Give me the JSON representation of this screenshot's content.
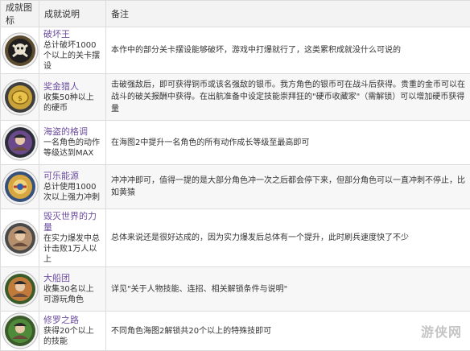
{
  "header": {
    "col_icon": "成就图标",
    "col_desc": "成就说明",
    "col_note": "备注"
  },
  "rows": [
    {
      "name": "破坏王",
      "desc": "总计破坏1000个以上的关卡摆设",
      "note": "本作中的部分关卡摆设能够破坏，游戏中打爆就行了，这类累积成就没什么可说的",
      "icon": "skull-crossbones-icon",
      "colors": {
        "ring": "#5a4a2e",
        "center": "#1e1e1e"
      }
    },
    {
      "name": "奖金猎人",
      "desc": "收集50种以上的硬币",
      "note": "击破强敌后，即可获得铜币或该名强敌的银币。我方角色的银币可在战斗后获得。贵重的金币可以在战斗的破关报酬中获得。在出航准备中设定技能崇拜狂的\"硬币收藏家\"（需解锁）可以增加硬币获得量",
      "icon": "gold-coin-icon",
      "colors": {
        "ring": "#3e3e3e",
        "center": "#c9a23a"
      }
    },
    {
      "name": "海盗的格调",
      "desc": "一名角色的动作等级达到MAX",
      "note": "在海图2中提升一名角色的所有动作成长等级至最高即可",
      "icon": "pirate-portrait-icon",
      "colors": {
        "ring": "#2d2d3a",
        "center": "#6a4a8a"
      }
    },
    {
      "name": "可乐能源",
      "desc": "总计使用1000次以上强力冲刺",
      "note": "冲冲冲即可，值得一提的是大部分角色冲一次之后都会停下来，但部分角色可以一直冲刺不停止，比如黄猿",
      "icon": "cola-bottle-icon",
      "colors": {
        "ring": "#35507a",
        "center": "#d6a640"
      }
    },
    {
      "name": "毁灭世界的力量",
      "desc": "在实力爆发中总计击败1万人以上",
      "note": "总体来说还是很好达成的，因为实力爆发后总体有一个提升，此时刷兵速度快了不少",
      "icon": "warrior-portrait-icon",
      "colors": {
        "ring": "#4a4a4a",
        "center": "#b48f6e"
      }
    },
    {
      "name": "大船团",
      "desc": "收集30名以上可游玩角色",
      "note": "详见\"关于人物技能、连招、相关解锁条件与说明\"",
      "icon": "crew-group-icon",
      "colors": {
        "ring": "#3a5a2a",
        "center": "#c07a3a"
      }
    },
    {
      "name": "修罗之路",
      "desc": "获得20个以上的技能",
      "note": "不同角色海图2解锁共20个以上的特殊技即可",
      "icon": "swordsman-portrait-icon",
      "colors": {
        "ring": "#3a5a2a",
        "center": "#4f8a3a"
      }
    }
  ],
  "watermark": "游侠网"
}
